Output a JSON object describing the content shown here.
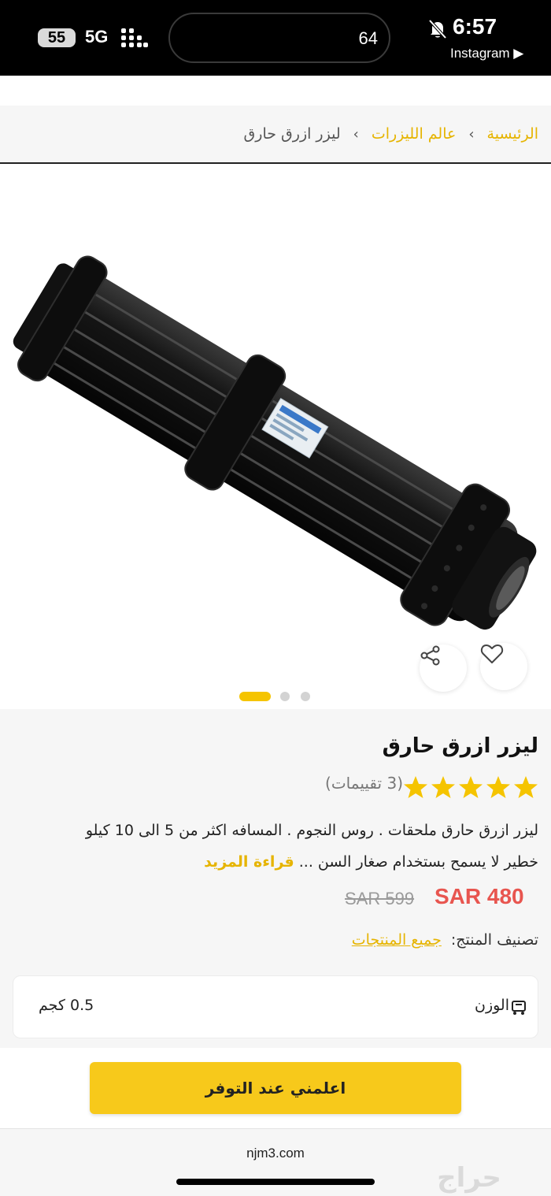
{
  "status_bar": {
    "battery": "55",
    "network": "5G",
    "island_value": "64",
    "time": "6:57",
    "back_app": "Instagram ▶"
  },
  "breadcrumb": {
    "items": [
      "الرئيسية",
      "عالم الليزرات"
    ],
    "current": "ليزر ازرق حارق",
    "separator": "›"
  },
  "gallery": {
    "slides": 3,
    "active_slide": 1,
    "product_image": "black-laser-pointer"
  },
  "product": {
    "title": "ليزر ازرق حارق",
    "rating": 5,
    "ratings_count": "(3 تقييمات)",
    "description_line1": "ليزر ازرق حارق ملحقات . روس النجوم . المسافه اكثر من 5 الى 10 كيلو",
    "description_line2": "خطير لا يسمح بستخدام صغار السن ...",
    "read_more": "قراءة المزيد",
    "price": "SAR 480",
    "old_price": "SAR 599",
    "category_label": "تصنيف المنتج:",
    "category_value": "جميع المنتجات",
    "weight_label": "الوزن",
    "weight_value": "0.5 كجم"
  },
  "actions": {
    "notify_button": "اعلمني عند التوفر"
  },
  "footer": {
    "domain": "njm3.com",
    "watermark": "حراج"
  },
  "colors": {
    "accent": "#f7c91b",
    "link": "#e6b400",
    "price": "#e8554f",
    "panel_bg": "#f6f6f6"
  }
}
